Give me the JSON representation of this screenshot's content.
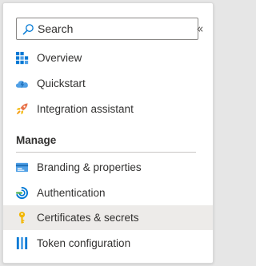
{
  "search": {
    "placeholder": "Search",
    "value": ""
  },
  "collapse": {
    "glyph": "«"
  },
  "menu": {
    "items": [
      {
        "label": "Overview",
        "icon": "grid-icon"
      },
      {
        "label": "Quickstart",
        "icon": "cloud-lightning-icon"
      },
      {
        "label": "Integration assistant",
        "icon": "rocket-icon"
      }
    ]
  },
  "manage": {
    "title": "Manage",
    "items": [
      {
        "label": "Branding & properties",
        "icon": "card-icon"
      },
      {
        "label": "Authentication",
        "icon": "authentication-icon"
      },
      {
        "label": "Certificates & secrets",
        "icon": "key-icon",
        "selected": true
      },
      {
        "label": "Token configuration",
        "icon": "token-bars-icon"
      }
    ]
  },
  "colors": {
    "accent": "#0078d4",
    "selected_bg": "#edebe9",
    "key_yellow": "#f2b600",
    "text": "#323130"
  }
}
